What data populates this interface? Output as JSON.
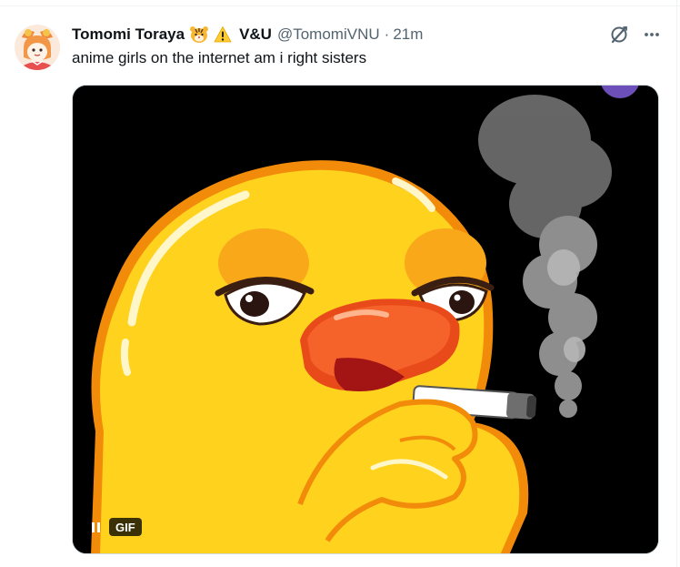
{
  "tweet": {
    "author_name": "Tomomi Toraya",
    "emojis": [
      "tiger-face-icon",
      "warning-icon"
    ],
    "name_suffix": "V&U",
    "handle": "@TomomiVNU",
    "separator": "·",
    "time": "21m",
    "text": "anime girls on the internet am i right sisters"
  },
  "media": {
    "gif_label": "GIF",
    "playback": "playing"
  },
  "actions": {
    "grok_icon": "grok-icon",
    "more_icon": "more-icon"
  },
  "colors": {
    "text": "#0f1419",
    "secondary": "#536471",
    "duck_yellow": "#ffd21e",
    "beak_orange": "#f5622a"
  }
}
